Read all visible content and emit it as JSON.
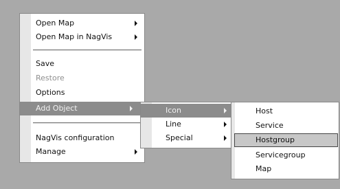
{
  "menu_main": {
    "items": [
      {
        "label": "Open Map",
        "submenu": true
      },
      {
        "label": "Open Map in NagVis",
        "submenu": true
      },
      {
        "label": "Save",
        "submenu": false,
        "disabled": false
      },
      {
        "label": "Restore",
        "submenu": false,
        "disabled": true
      },
      {
        "label": "Options",
        "submenu": false
      },
      {
        "label": "Add Object",
        "submenu": true,
        "active": true
      },
      {
        "label": "NagVis configuration",
        "submenu": false
      },
      {
        "label": "Manage",
        "submenu": true
      }
    ]
  },
  "menu_add_object": {
    "items": [
      {
        "label": "Icon",
        "submenu": true,
        "active": true
      },
      {
        "label": "Line",
        "submenu": true
      },
      {
        "label": "Special",
        "submenu": true
      }
    ]
  },
  "menu_icon": {
    "items": [
      {
        "label": "Host"
      },
      {
        "label": "Service"
      },
      {
        "label": "Hostgroup",
        "highlighted": true
      },
      {
        "label": "Servicegroup"
      },
      {
        "label": "Map"
      }
    ]
  }
}
